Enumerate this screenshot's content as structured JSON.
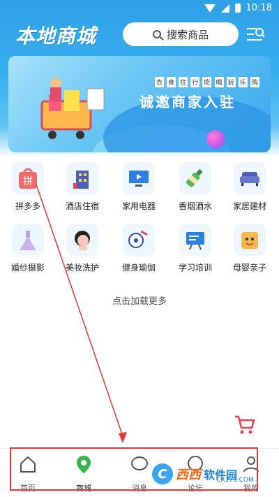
{
  "status_bar": {
    "time": "10:18"
  },
  "header": {
    "title": "本地商城",
    "search_placeholder": "搜索商品"
  },
  "banner": {
    "slogan_small": [
      "衣",
      "食",
      "住",
      "行",
      "吃",
      "喝",
      "玩",
      "乐",
      "购"
    ],
    "title": "诚邀商家入驻"
  },
  "categories": [
    {
      "label": "拼多多",
      "icon": "pinduoduo-icon",
      "icon_text": "拼"
    },
    {
      "label": "酒店住宿",
      "icon": "hotel-icon"
    },
    {
      "label": "家用电器",
      "icon": "appliance-icon"
    },
    {
      "label": "香烟酒水",
      "icon": "liquor-icon"
    },
    {
      "label": "家居建材",
      "icon": "furniture-icon"
    },
    {
      "label": "婚纱摄影",
      "icon": "wedding-dress-icon"
    },
    {
      "label": "美妆洗护",
      "icon": "beauty-icon"
    },
    {
      "label": "健身瑜伽",
      "icon": "fitness-icon"
    },
    {
      "label": "学习培训",
      "icon": "training-board-icon"
    },
    {
      "label": "母婴亲子",
      "icon": "baby-icon"
    }
  ],
  "load_more": "点击加载更多",
  "bottom_nav": [
    {
      "label": "首页",
      "icon": "home-icon"
    },
    {
      "label": "商城",
      "icon": "location-icon",
      "active": true
    },
    {
      "label": "消息",
      "icon": "message-icon"
    },
    {
      "label": "论坛",
      "icon": "forum-icon"
    },
    {
      "label": "我的",
      "icon": "profile-icon"
    }
  ],
  "watermark": {
    "logo": "C",
    "text1": "西西",
    "text2": "软件园",
    "url": "CR173.COM"
  },
  "colors": {
    "primary": "#2fa1e6",
    "active_nav": "#3bb54a",
    "annotation": "#e03a3a",
    "cart": "#e8414b"
  }
}
